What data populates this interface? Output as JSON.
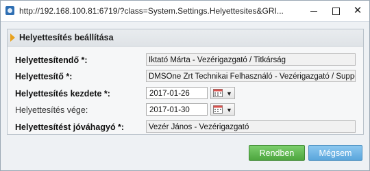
{
  "window": {
    "url": "http://192.168.100.81:6719/?class=System.Settings.Helyettesites&GRI..."
  },
  "dialog": {
    "title": "Helyettesítés beállítása",
    "fields": {
      "helyettesitendo_label": "Helyettesítendő *:",
      "helyettesitendo_value": "Iktató Márta - Vezérigazgató / Titkárság",
      "helyettesito_label": "Helyettesítő *:",
      "helyettesito_value": "DMSOne Zrt Technikai Felhasználó - Vezérigazgató / Support",
      "kezdete_label": "Helyettesítés kezdete *:",
      "kezdete_value": "2017-01-26",
      "vege_label": "Helyettesítés vége:",
      "vege_value": "2017-01-30",
      "jovahagyo_label": "Helyettesítést jóváhagyó *:",
      "jovahagyo_value": "Vezér János - Vezérigazgató"
    }
  },
  "buttons": {
    "ok_label": "Rendben",
    "cancel_label": "Mégsem"
  },
  "colors": {
    "header_accent": "#e8a11c",
    "ok_green": "#5cb84c",
    "cancel_blue": "#6cb4e6"
  }
}
